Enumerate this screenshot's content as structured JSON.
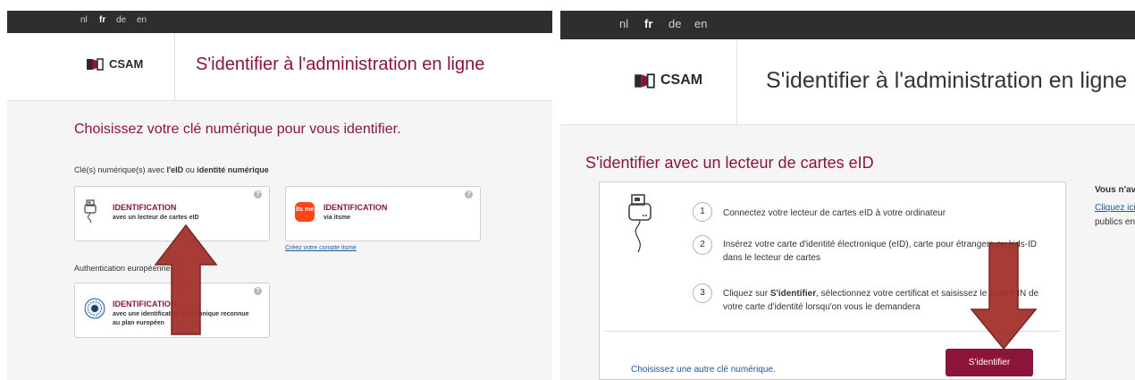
{
  "colors": {
    "brand": "#8b1538",
    "langbar": "#2e2e2e",
    "link": "#1d5aa0",
    "arrow": "#a3322c",
    "background": "#f5f5f5"
  },
  "left": {
    "languages": [
      "nl",
      "fr",
      "de",
      "en"
    ],
    "active_language": "fr",
    "logo_text": "CSAM",
    "header_title": "S'identifier à l'administration en ligne",
    "heading": "Choisissez votre clé numérique pour vous identifier.",
    "keys_label": {
      "prefix": "Clé(s) numérique(s) avec ",
      "eid": "l'eID",
      "middle": " ou ",
      "digital": "identité numérique"
    },
    "cards": {
      "eid": {
        "title": "IDENTIFICATION",
        "subtitle": "avec un lecteur de cartes eID",
        "help": "?",
        "icon": "card-reader-icon"
      },
      "itsme": {
        "title": "IDENTIFICATION",
        "subtitle": "via itsme",
        "help": "?",
        "icon": "itsme-logo",
        "logo_text": "its me"
      },
      "european": {
        "title": "IDENTIFICATION",
        "subtitle": "avec une identification électronique reconnue au plan européen",
        "help": "?",
        "icon": "european-id-icon"
      }
    },
    "itsme_link": "Créez votre compte itsme",
    "european_label": "Authentication européenne"
  },
  "right": {
    "languages": [
      "nl",
      "fr",
      "de",
      "en"
    ],
    "active_language": "fr",
    "logo_text": "CSAM",
    "header_title": "S'identifier à l'administration en ligne",
    "heading": "S'identifier avec un lecteur de cartes eID",
    "steps": [
      {
        "number": "1",
        "text": "Connectez votre lecteur de cartes eID à votre ordinateur"
      },
      {
        "number": "2",
        "text": "Insérez votre carte d'identité électronique (eID), carte pour étrangers ou kids-ID dans le lecteur de cartes"
      },
      {
        "number": "3",
        "text_before": "Cliquez sur ",
        "text_bold": "S'identifier",
        "text_after": ", sélectionnez votre certificat et saisissez le code PIN de votre carte d'identité lorsqu'on vous le demandera"
      }
    ],
    "other_key_link": "Choisissez une autre clé numérique.",
    "identify_button": "S'identifier",
    "side_title": "Vous n'av",
    "side_link": "Cliquez ici",
    "side_text": "publics en"
  }
}
